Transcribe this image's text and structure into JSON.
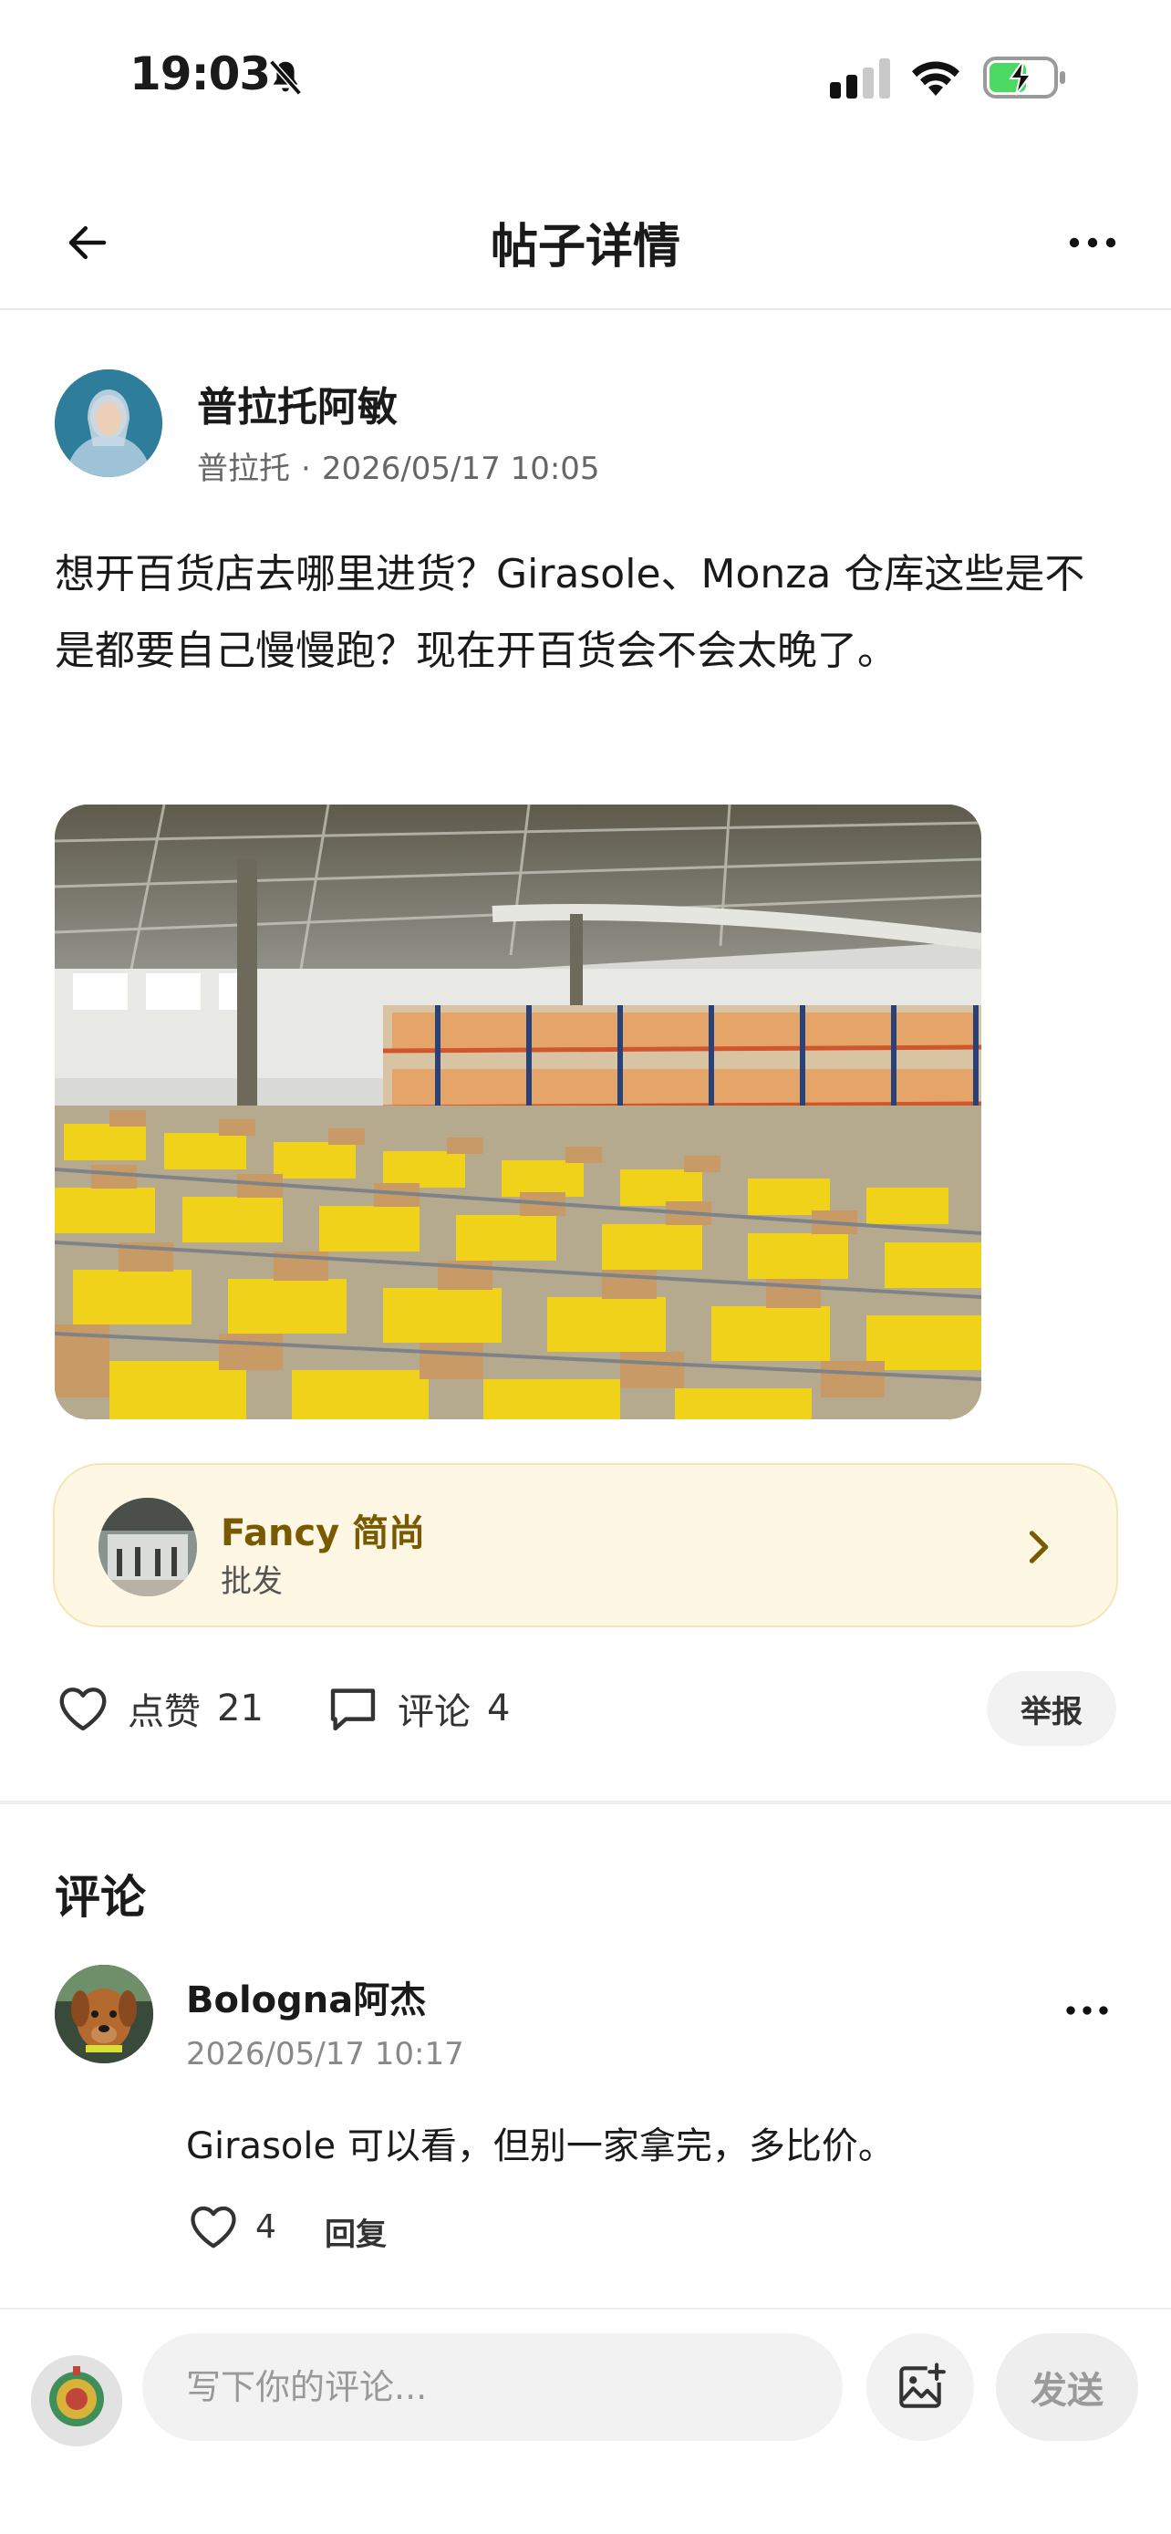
{
  "status_bar": {
    "time": "19:03",
    "icons": [
      "bell-off-icon",
      "cellular-signal-icon",
      "wifi-icon",
      "battery-charging-icon"
    ]
  },
  "nav": {
    "title": "帖子详情",
    "back_icon": "arrow-left-icon",
    "more_icon": "more-horizontal-icon"
  },
  "post": {
    "author_name": "普拉托阿敏",
    "author_tag": "普拉托",
    "separator": "·",
    "timestamp": "2026/05/17 10:05",
    "text": "想开百货店去哪里进货？Girasole、Monza 仓库这些是不是都要自己慢慢跑？现在开百货会不会太晚了。",
    "image_subject": "warehouse"
  },
  "shop_card": {
    "name": "Fancy 简尚",
    "category": "批发",
    "chevron_icon": "chevron-right-icon"
  },
  "actions": {
    "like_label": "点赞",
    "like_count": "21",
    "comment_label": "评论",
    "comment_count": "4",
    "report_label": "举报"
  },
  "comments": {
    "heading": "评论",
    "items": [
      {
        "author": "Bologna阿杰",
        "time": "2026/05/17 10:17",
        "text": "Girasole 可以看，但别一家拿完，多比价。",
        "likes": "4",
        "reply_label": "回复"
      }
    ]
  },
  "input_bar": {
    "placeholder": "写下你的评论...",
    "send_label": "发送",
    "image_icon": "add-image-icon"
  },
  "colors": {
    "shop_card_bg": "#fdf7e3",
    "shop_name": "#7a5a00",
    "battery_green": "#4cd964"
  }
}
